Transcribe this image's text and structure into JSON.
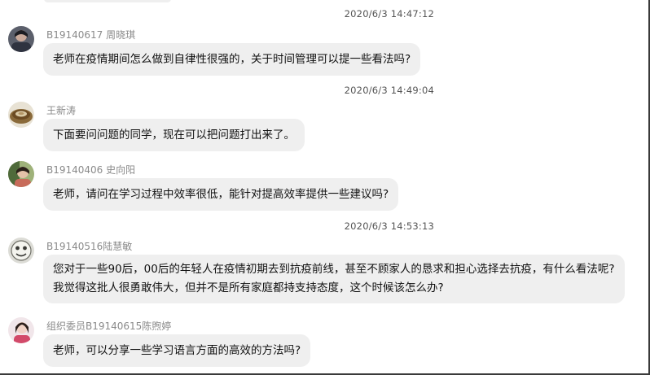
{
  "messages": [
    {
      "timestamp": "2020/6/3 14:47:12",
      "sender": "B19140617 周晓琪",
      "lines": [
        "老师在疫情期间怎么做到自律性很强的，关于时间管理可以提一些看法吗?"
      ]
    },
    {
      "timestamp": "2020/6/3 14:49:04",
      "sender": "王新涛",
      "lines": [
        "下面要问问题的同学，现在可以把问题打出来了。"
      ]
    },
    {
      "timestamp": "",
      "sender": "B19140406 史向阳",
      "lines": [
        "老师，请问在学习过程中效率很低，能针对提高效率提供一些建议吗?"
      ]
    },
    {
      "timestamp": "2020/6/3 14:53:13",
      "sender": "B19140516陆慧敏",
      "lines": [
        "您对于一些90后，00后的年轻人在疫情初期去到抗疫前线，甚至不顾家人的恳求和担心选择去抗疫，有什么看法呢?",
        "我觉得这批人很勇敢伟大，但并不是所有家庭都持支持态度，这个时候该怎么办?"
      ]
    },
    {
      "timestamp": "",
      "sender": "组织委员B19140615陈煦婷",
      "lines": [
        "老师，可以分享一些学习语言方面的高效的方法吗?"
      ]
    }
  ]
}
